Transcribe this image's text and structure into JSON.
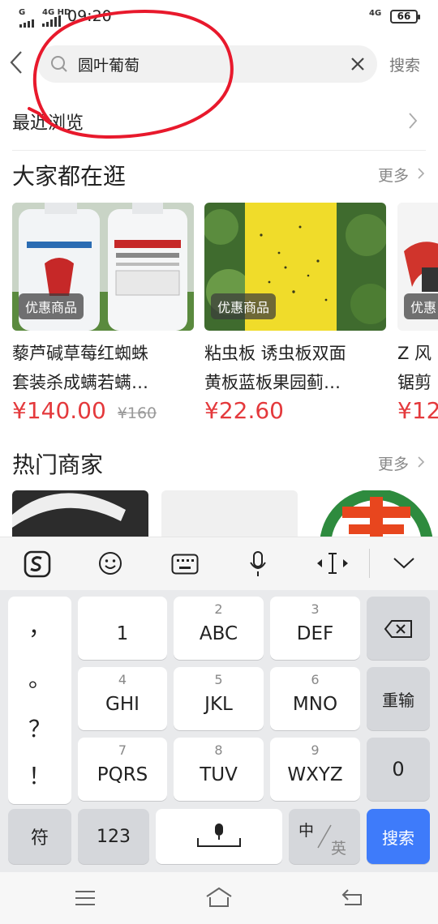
{
  "status_bar": {
    "sim1": "G",
    "sim2": "4G HD",
    "time": "09:20",
    "net_right": "4G",
    "battery": "66"
  },
  "search": {
    "query": "圆叶葡萄",
    "button_label": "搜索"
  },
  "recent": {
    "label": "最近浏览"
  },
  "trending": {
    "title": "大家都在逛",
    "more_label": "更多",
    "products": [
      {
        "badge": "优惠商品",
        "title_line1": "藜芦碱草莓红蜘蛛",
        "title_line2": "套装杀成螨若螨…",
        "price": "¥140.00",
        "old_price": "¥160"
      },
      {
        "badge": "优惠商品",
        "title_line1": "粘虫板 诱虫板双面",
        "title_line2": "黄板蓝板果园蓟…",
        "price": "¥22.60",
        "old_price": ""
      },
      {
        "badge": "优惠",
        "title_line1": "Z 风",
        "title_line2": "锯剪",
        "price": "¥12",
        "old_price": ""
      }
    ]
  },
  "merchants": {
    "title": "热门商家",
    "more_label": "更多"
  },
  "keyboard": {
    "toolbar": [
      "sogou-icon",
      "emoji-icon",
      "keyboard-icon",
      "mic-icon",
      "cursor-icon",
      "collapse-icon"
    ],
    "punct": [
      "，",
      "。",
      "？",
      "！"
    ],
    "keys": {
      "k1": {
        "num": "",
        "label": "1"
      },
      "k2": {
        "num": "2",
        "label": "ABC"
      },
      "k3": {
        "num": "3",
        "label": "DEF"
      },
      "k4": {
        "num": "4",
        "label": "GHI"
      },
      "k5": {
        "num": "5",
        "label": "JKL"
      },
      "k6": {
        "num": "6",
        "label": "MNO"
      },
      "k7": {
        "num": "7",
        "label": "PQRS"
      },
      "k8": {
        "num": "8",
        "label": "TUV"
      },
      "k9": {
        "num": "9",
        "label": "WXYZ"
      }
    },
    "reinput": "重输",
    "zero": "0",
    "symbols": "符",
    "num123": "123",
    "lang_zh": "中",
    "lang_en": "英",
    "search_key": "搜索"
  },
  "colors": {
    "price": "#e4393c",
    "search_key": "#3e7bfa",
    "annotation": "#e8192c"
  }
}
